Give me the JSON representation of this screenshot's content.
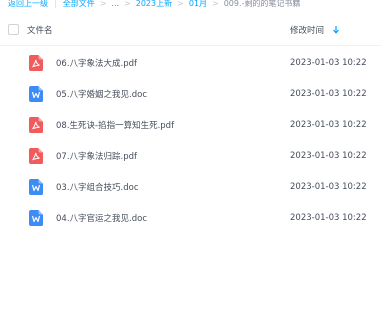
{
  "breadcrumb": {
    "back": "返回上一级",
    "all": "全部文件",
    "ellipsis": "...",
    "level1": "2023上新",
    "level2": "01月",
    "current": "009.-剩的的笔记书籍"
  },
  "table": {
    "col_name": "文件名",
    "col_time": "修改时间",
    "rows": [
      {
        "name": "06.八字象法大成.pdf",
        "type": "pdf",
        "time": "2023-01-03 10:22"
      },
      {
        "name": "05.八字婚姻之我见.doc",
        "type": "doc",
        "time": "2023-01-03 10:22"
      },
      {
        "name": "08.生死诀-掐指一算知生死.pdf",
        "type": "pdf",
        "time": "2023-01-03 10:22"
      },
      {
        "name": "07.八字象法归踪.pdf",
        "type": "pdf",
        "time": "2023-01-03 10:22"
      },
      {
        "name": "03.八字组合技巧.doc",
        "type": "doc",
        "time": "2023-01-03 10:22"
      },
      {
        "name": "04.八字官运之我见.doc",
        "type": "doc",
        "time": "2023-01-03 10:22"
      }
    ]
  },
  "colors": {
    "link": "#06a7ff",
    "pdf": "#f15b5b",
    "doc": "#3d8cf5"
  },
  "icons": {
    "pdf": "pdf-file-icon",
    "doc": "word-file-icon",
    "sort": "sort-down-arrow-icon"
  }
}
